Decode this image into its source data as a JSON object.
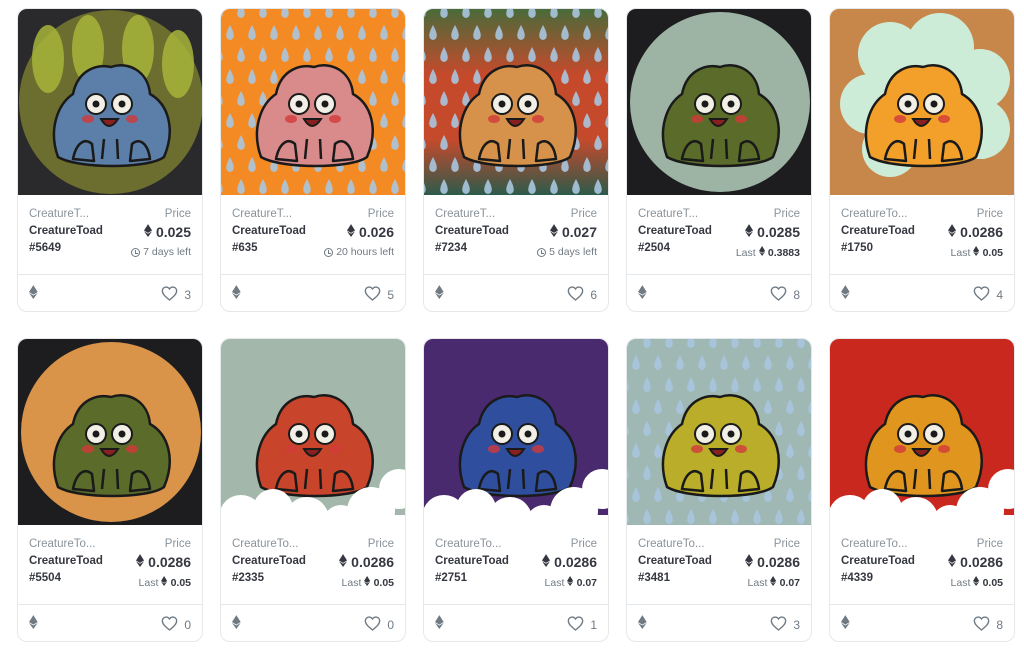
{
  "currency_icon": "ethereum-icon",
  "like_icon": "heart-icon",
  "cards": [
    {
      "collection": "CreatureT...",
      "name": "CreatureToad",
      "token": "#5649",
      "price_label": "Price",
      "price": "0.025",
      "sub_type": "time",
      "sub": "7 days left",
      "likes": "3",
      "bg": "#6b6e2e",
      "body": "#5b7fa8",
      "style": "bushes"
    },
    {
      "collection": "CreatureT...",
      "name": "CreatureToad",
      "token": "#635",
      "price_label": "Price",
      "price": "0.026",
      "sub_type": "time",
      "sub": "20 hours left",
      "likes": "5",
      "bg": "#f48a23",
      "body": "#d98b8b",
      "style": "rain"
    },
    {
      "collection": "CreatureT...",
      "name": "CreatureToad",
      "token": "#7234",
      "price_label": "Price",
      "price": "0.027",
      "sub_type": "time",
      "sub": "5 days left",
      "likes": "6",
      "bg": "#c54a2c",
      "body": "#d6924a",
      "style": "rainbow"
    },
    {
      "collection": "CreatureT...",
      "name": "CreatureToad",
      "token": "#2504",
      "price_label": "Price",
      "price": "0.0285",
      "sub_type": "last",
      "sub_label": "Last",
      "sub": "0.3883",
      "likes": "8",
      "bg": "#1d1d1f",
      "body": "#5a6b2a",
      "style": "circle",
      "circle": "#9db4a4"
    },
    {
      "collection": "CreatureTo...",
      "name": "CreatureToad",
      "token": "#1750",
      "price_label": "Price",
      "price": "0.0286",
      "sub_type": "last",
      "sub_label": "Last",
      "sub": "0.05",
      "likes": "4",
      "bg": "#c8874a",
      "body": "#f2a02a",
      "style": "cloudbg"
    },
    {
      "collection": "CreatureTo...",
      "name": "CreatureToad",
      "token": "#5504",
      "price_label": "Price",
      "price": "0.0286",
      "sub_type": "last",
      "sub_label": "Last",
      "sub": "0.05",
      "likes": "0",
      "bg": "#1d1d1f",
      "body": "#5a6b2a",
      "style": "circle",
      "circle": "#d9944a"
    },
    {
      "collection": "CreatureTo...",
      "name": "CreatureToad",
      "token": "#2335",
      "price_label": "Price",
      "price": "0.0286",
      "sub_type": "last",
      "sub_label": "Last",
      "sub": "0.05",
      "likes": "0",
      "bg": "#a3b8ab",
      "body": "#c8452c",
      "style": "clouds"
    },
    {
      "collection": "CreatureTo...",
      "name": "CreatureToad",
      "token": "#2751",
      "price_label": "Price",
      "price": "0.0286",
      "sub_type": "last",
      "sub_label": "Last",
      "sub": "0.07",
      "likes": "1",
      "bg": "#4a2a6e",
      "body": "#2f4f9e",
      "style": "clouds"
    },
    {
      "collection": "CreatureTo...",
      "name": "CreatureToad",
      "token": "#3481",
      "price_label": "Price",
      "price": "0.0286",
      "sub_type": "last",
      "sub_label": "Last",
      "sub": "0.07",
      "likes": "3",
      "bg": "#9fb8b4",
      "body": "#b9ad2a",
      "style": "rain"
    },
    {
      "collection": "CreatureTo...",
      "name": "CreatureToad",
      "token": "#4339",
      "price_label": "Price",
      "price": "0.0286",
      "sub_type": "last",
      "sub_label": "Last",
      "sub": "0.05",
      "likes": "8",
      "bg": "#c9281f",
      "body": "#e0961e",
      "style": "clouds"
    }
  ]
}
